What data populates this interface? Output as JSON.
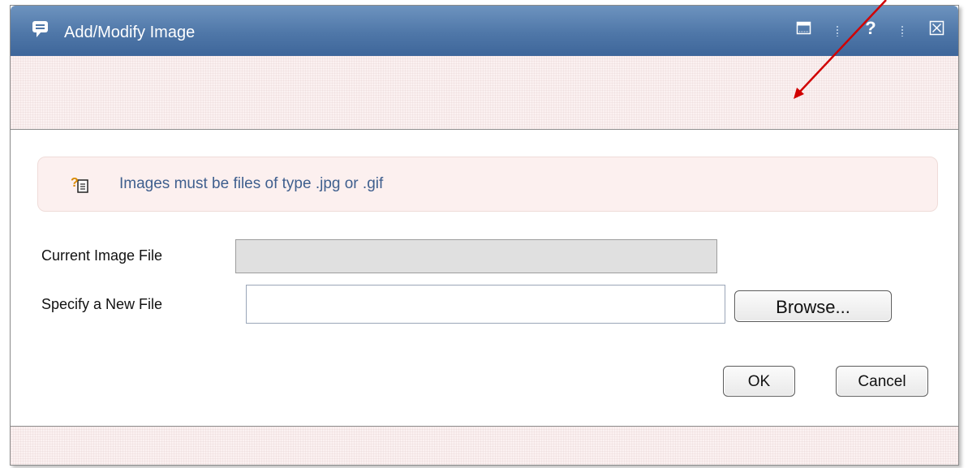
{
  "dialog": {
    "title": "Add/Modify Image",
    "icons": {
      "title": "speech-bubble-icon",
      "restore": "window-restore-icon",
      "help": "help-icon",
      "close": "close-icon"
    },
    "help_glyph": "?"
  },
  "info": {
    "icon": "question-note-icon",
    "text": "Images must be files of type .jpg or .gif"
  },
  "form": {
    "current_label": "Current Image File",
    "current_value": "",
    "new_label": "Specify a New File",
    "new_value": "",
    "browse_label": "Browse..."
  },
  "buttons": {
    "ok": "OK",
    "cancel": "Cancel"
  },
  "colors": {
    "titlebar": "#4f77a8",
    "info_text": "#3f5f8e",
    "annotation_arrow": "#d10000"
  }
}
